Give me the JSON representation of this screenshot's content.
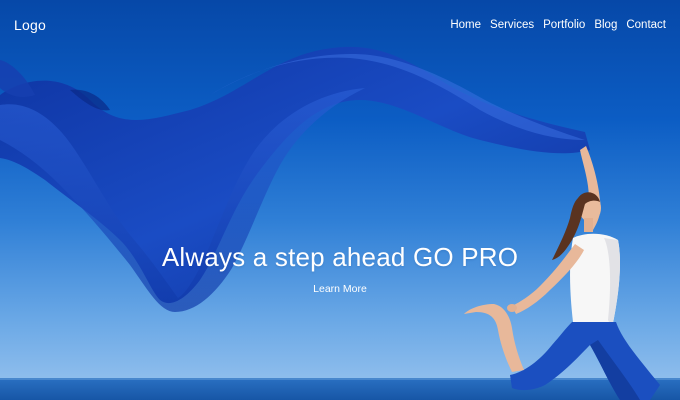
{
  "header": {
    "logo": "Logo",
    "nav": [
      "Home",
      "Services",
      "Portfolio",
      "Blog",
      "Contact"
    ]
  },
  "hero": {
    "headline": "Always a step ahead GO PRO",
    "cta_label": "Learn More"
  },
  "colors": {
    "sky_top": "#0648a8",
    "sky_bottom": "#9cc6ef",
    "sea": "#1f67b8",
    "fabric": "#1540b4",
    "text": "#ffffff"
  }
}
